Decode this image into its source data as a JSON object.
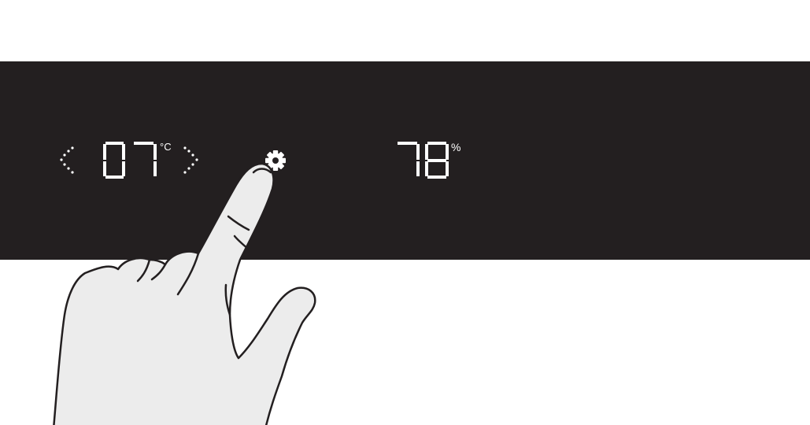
{
  "panel": {
    "temperature": {
      "value": "07",
      "unit": "°C",
      "decrease_icon": "chevron-left-icon",
      "increase_icon": "chevron-right-icon"
    },
    "settings_icon": "gear-icon",
    "humidity": {
      "value": "78",
      "unit": "%"
    }
  },
  "colors": {
    "panel_background": "#231f20",
    "display_foreground": "#ffffff",
    "hand_fill": "#ececec",
    "hand_outline": "#231f20"
  }
}
